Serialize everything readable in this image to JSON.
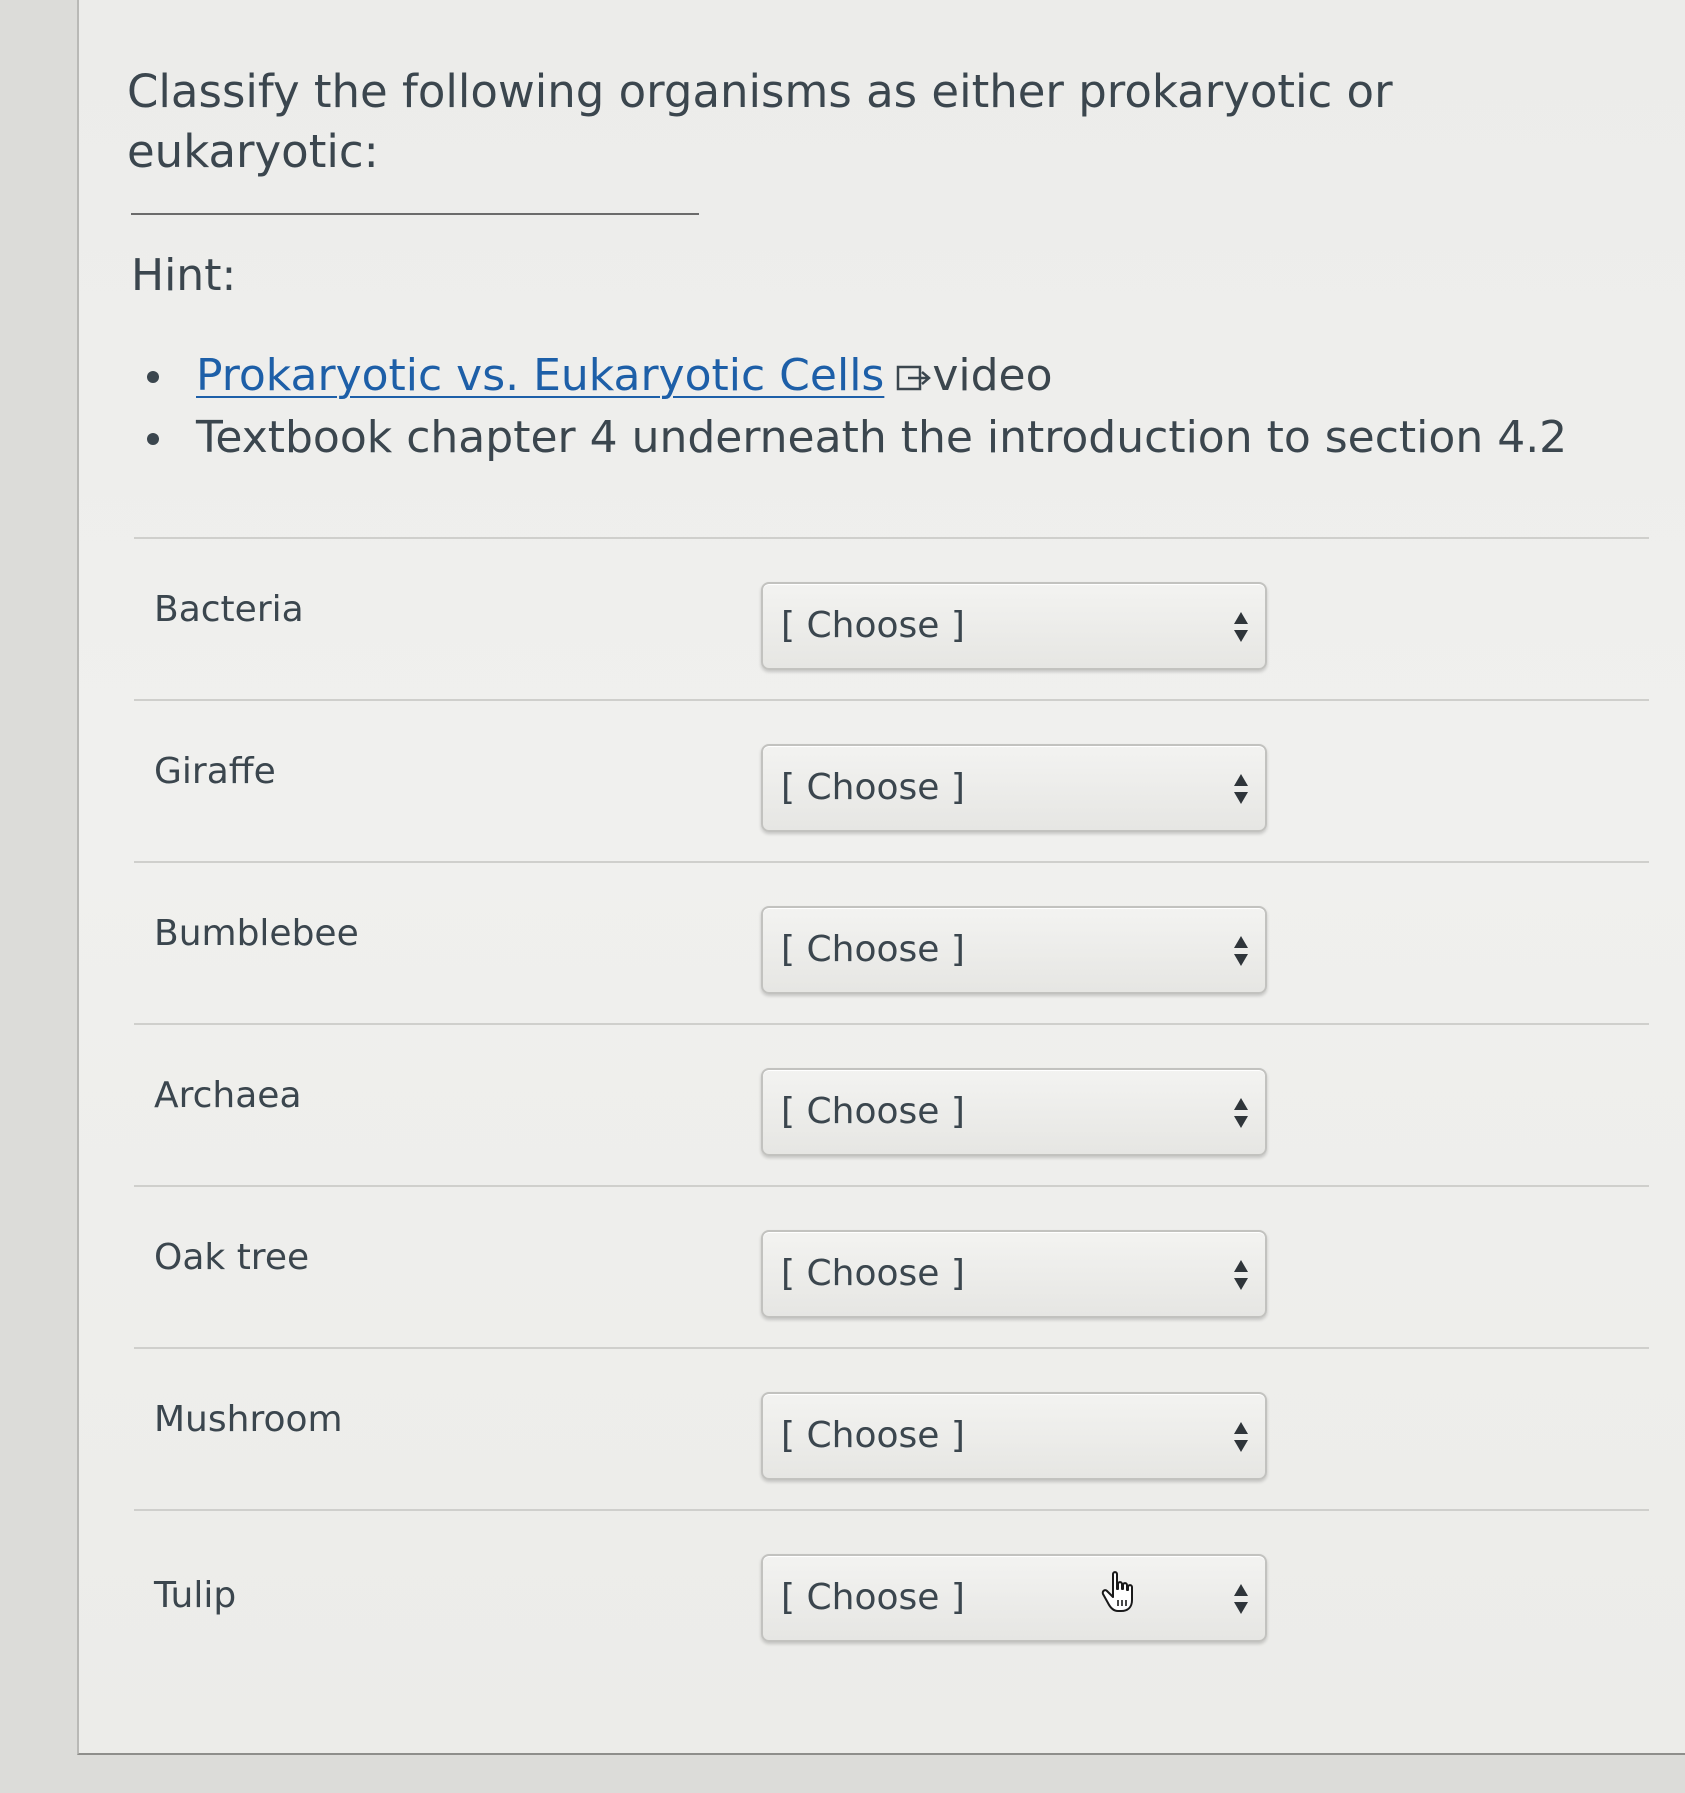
{
  "question": {
    "text": "Classify the following organisms as either prokaryotic or eukaryotic:"
  },
  "hint": {
    "label": "Hint:",
    "items": [
      {
        "link_text": "Prokaryotic vs. Eukaryotic Cells",
        "suffix_text": "video",
        "icon": "external-link-icon"
      },
      {
        "text": "Textbook chapter 4 underneath the introduction to section 4.2"
      }
    ]
  },
  "organisms": [
    {
      "label": "Bacteria",
      "selected": "[ Choose ]"
    },
    {
      "label": "Giraffe",
      "selected": "[ Choose ]"
    },
    {
      "label": "Bumblebee",
      "selected": "[ Choose ]"
    },
    {
      "label": "Archaea",
      "selected": "[ Choose ]"
    },
    {
      "label": "Oak tree",
      "selected": "[ Choose ]"
    },
    {
      "label": "Mushroom",
      "selected": "[ Choose ]"
    },
    {
      "label": "Tulip",
      "selected": "[ Choose ]"
    }
  ],
  "colors": {
    "link": "#1d5fa8",
    "text": "#3b464e",
    "page_background": "#efefed"
  },
  "pointer": {
    "icon": "hand-pointer-icon"
  }
}
